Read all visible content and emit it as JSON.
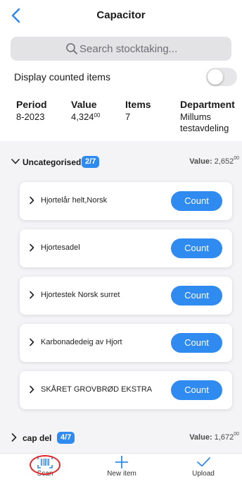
{
  "header": {
    "title": "Capacitor"
  },
  "search": {
    "placeholder": "Search stocktaking..."
  },
  "toggle": {
    "label": "Display counted items",
    "on": false
  },
  "info": {
    "period": {
      "label": "Period",
      "value": "8-2023"
    },
    "value": {
      "label": "Value",
      "value": "4,324",
      "decimals": "00"
    },
    "items": {
      "label": "Items",
      "value": "7"
    },
    "department": {
      "label": "Department",
      "line1": "Millums",
      "line2": "testavdeling"
    }
  },
  "groups": [
    {
      "name": "Uncategorised",
      "badge": "2/7",
      "value_label": "Value:",
      "value": "2,652",
      "decimals": "00",
      "expanded": true,
      "items": [
        {
          "name": "Hjortelår helt,Norsk",
          "button": "Count"
        },
        {
          "name": "Hjortesadel",
          "button": "Count"
        },
        {
          "name": "Hjortestek Norsk surret",
          "button": "Count"
        },
        {
          "name": "Karbonadedeig av Hjort",
          "button": "Count"
        },
        {
          "name": "SKÅRET GROVBRØD EKSTRA",
          "button": "Count"
        }
      ]
    },
    {
      "name": "cap del",
      "badge": "4/7",
      "value_label": "Value:",
      "value": "1,672",
      "decimals": "00",
      "expanded": false
    }
  ],
  "bottom_nav": [
    {
      "label": "Scan",
      "icon": "barcode-scan-icon"
    },
    {
      "label": "New item",
      "icon": "plus-icon"
    },
    {
      "label": "Upload",
      "icon": "checkmark-icon"
    }
  ],
  "colors": {
    "accent": "#2f8bf0",
    "highlight_ring": "#e5262a"
  }
}
